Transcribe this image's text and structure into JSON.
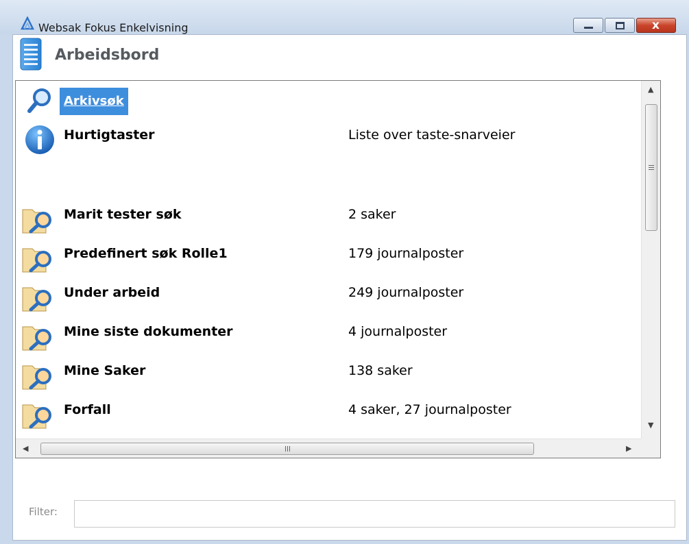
{
  "window": {
    "title": "Websak Fokus Enkelvisning",
    "close_glyph": "x",
    "accent": "#3e8ede"
  },
  "header": {
    "title": "Arbeidsbord",
    "icon": "document-icon"
  },
  "list": {
    "items": [
      {
        "name": "Arkivsøk",
        "desc": "",
        "icon": "search-icon",
        "selected": true
      },
      {
        "name": "Hurtigtaster",
        "desc": "Liste over taste-snarveier",
        "icon": "info-icon"
      },
      {
        "name": "Marit tester søk",
        "desc": "2 saker",
        "icon": "folder-search-icon"
      },
      {
        "name": "Predefinert søk Rolle1",
        "desc": "179 journalposter",
        "icon": "folder-search-icon"
      },
      {
        "name": "Under arbeid",
        "desc": "249 journalposter",
        "icon": "folder-search-icon"
      },
      {
        "name": "Mine siste dokumenter",
        "desc": "4 journalposter",
        "icon": "folder-search-icon"
      },
      {
        "name": "Mine Saker",
        "desc": "138 saker",
        "icon": "folder-search-icon"
      },
      {
        "name": "Forfall",
        "desc": "4 saker, 27 journalposter",
        "icon": "folder-search-icon"
      }
    ]
  },
  "filter": {
    "label": "Filter:",
    "value": "",
    "placeholder": ""
  }
}
